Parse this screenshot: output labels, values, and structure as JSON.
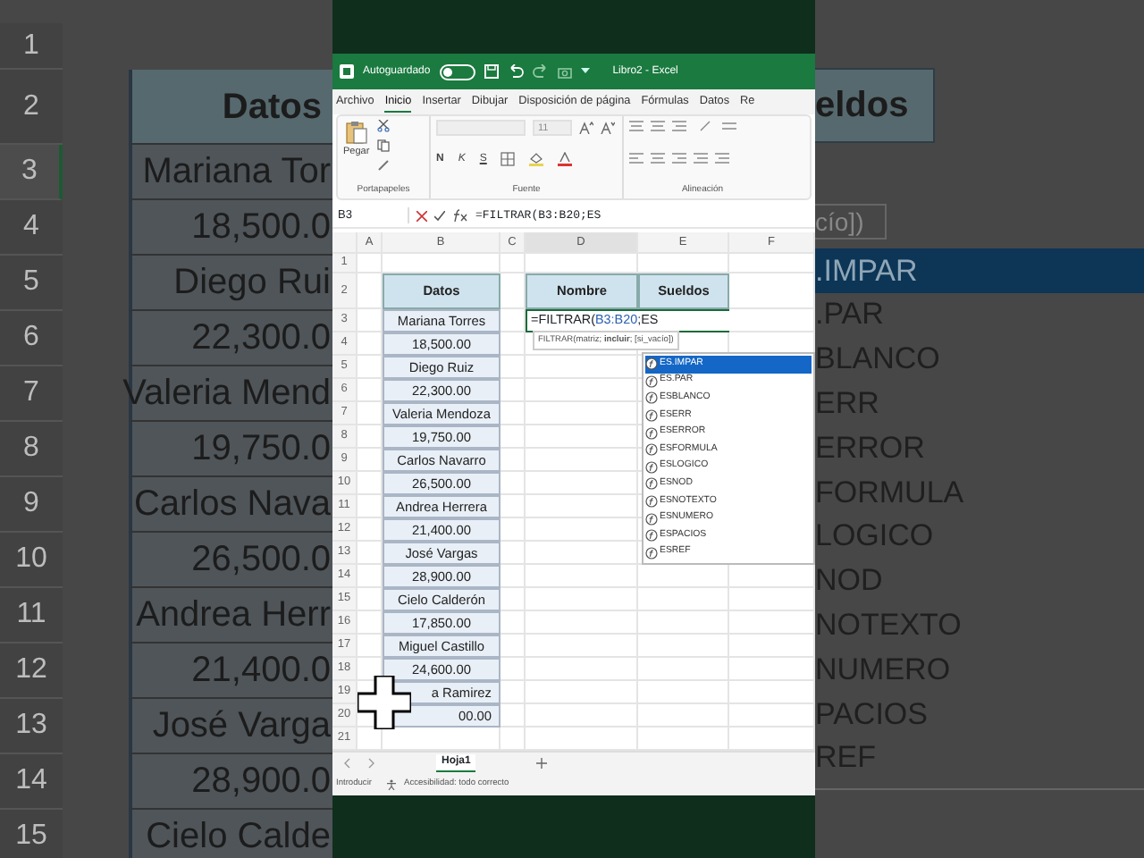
{
  "backdrop_left": {
    "row_numbers": [
      "1",
      "2",
      "3",
      "4",
      "5",
      "6",
      "7",
      "8",
      "9",
      "10",
      "11",
      "12",
      "13",
      "14",
      "15"
    ],
    "header": "Datos",
    "cells": [
      "Mariana Tor",
      "18,500.0",
      "Diego Rui",
      "22,300.0",
      "Valeria Mend",
      "19,750.0",
      "Carlos Nava",
      "26,500.0",
      "Andrea Herr",
      "21,400.0",
      "José Varga",
      "28,900.0",
      "Cielo Calde"
    ]
  },
  "window": {
    "title": "Libro2 - Excel",
    "autosave_label": "Autoguardado",
    "autosave_on": false
  },
  "menu_tabs": [
    {
      "label": "Archivo",
      "selected": false
    },
    {
      "label": "Inicio",
      "selected": true
    },
    {
      "label": "Insertar",
      "selected": false
    },
    {
      "label": "Dibujar",
      "selected": false
    },
    {
      "label": "Disposición de página",
      "selected": false
    },
    {
      "label": "Fórmulas",
      "selected": false
    },
    {
      "label": "Datos",
      "selected": false
    },
    {
      "label": "Re",
      "selected": false
    }
  ],
  "ribbon": {
    "paste_label": "Pegar",
    "font_size": "11",
    "format_buttons": [
      "N",
      "K",
      "S"
    ],
    "groups": [
      "Portapapeles",
      "Fuente",
      "Alineación"
    ]
  },
  "formula_bar": {
    "name_box": "B3",
    "formula": "=FILTRAR(B3:B20;ES"
  },
  "sheet": {
    "columns": [
      "A",
      "B",
      "C",
      "D",
      "E",
      "F"
    ],
    "row_numbers": [
      "1",
      "2",
      "3",
      "4",
      "5",
      "6",
      "7",
      "8",
      "9",
      "10",
      "11",
      "12",
      "13",
      "14",
      "15",
      "16",
      "17",
      "18",
      "19",
      "20",
      "21"
    ],
    "data_header": "Datos",
    "data_values": [
      "Mariana Torres",
      "18,500.00",
      "Diego Ruiz",
      "22,300.00",
      "Valeria Mendoza",
      "19,750.00",
      "Carlos Navarro",
      "26,500.00",
      "Andrea Herrera",
      "21,400.00",
      "José Vargas",
      "28,900.00",
      "Cielo Calderón",
      "17,850.00",
      "Miguel Castillo",
      "24,600.00",
      "a Ramirez",
      "00.00"
    ],
    "result_headers": [
      "Nombre",
      "Sueldos"
    ],
    "editing_cell": {
      "prefix": "=FILTRAR(",
      "reference": "B3:B20",
      "suffix": ";ES"
    },
    "tooltip": "FILTRAR(matriz; **incluir**; [si_vacío])",
    "autocomplete": [
      {
        "label": "ES.IMPAR",
        "selected": true
      },
      {
        "label": "ES.PAR",
        "selected": false
      },
      {
        "label": "ESBLANCO",
        "selected": false
      },
      {
        "label": "ESERR",
        "selected": false
      },
      {
        "label": "ESERROR",
        "selected": false
      },
      {
        "label": "ESFORMULA",
        "selected": false
      },
      {
        "label": "ESLOGICO",
        "selected": false
      },
      {
        "label": "ESNOD",
        "selected": false
      },
      {
        "label": "ESNOTEXTO",
        "selected": false
      },
      {
        "label": "ESNUMERO",
        "selected": false
      },
      {
        "label": "ESPACIOS",
        "selected": false
      },
      {
        "label": "ESREF",
        "selected": false
      }
    ]
  },
  "sheet_tabs": [
    {
      "label": "Hoja1",
      "selected": true
    }
  ],
  "status_bar": {
    "mode": "Introducir",
    "accessibility": "Accesibilidad: todo correcto"
  },
  "backdrop_right": {
    "header": "eldos",
    "tooltip": "cío])",
    "items": [
      {
        "label": ".IMPAR",
        "selected": true
      },
      {
        "label": ".PAR",
        "selected": false
      },
      {
        "label": "BLANCO",
        "selected": false
      },
      {
        "label": "ERR",
        "selected": false
      },
      {
        "label": "ERROR",
        "selected": false
      },
      {
        "label": "FORMULA",
        "selected": false
      },
      {
        "label": "LOGICO",
        "selected": false
      },
      {
        "label": "NOD",
        "selected": false
      },
      {
        "label": "NOTEXTO",
        "selected": false
      },
      {
        "label": "NUMERO",
        "selected": false
      },
      {
        "label": "PACIOS",
        "selected": false
      },
      {
        "label": "REF",
        "selected": false
      }
    ]
  }
}
